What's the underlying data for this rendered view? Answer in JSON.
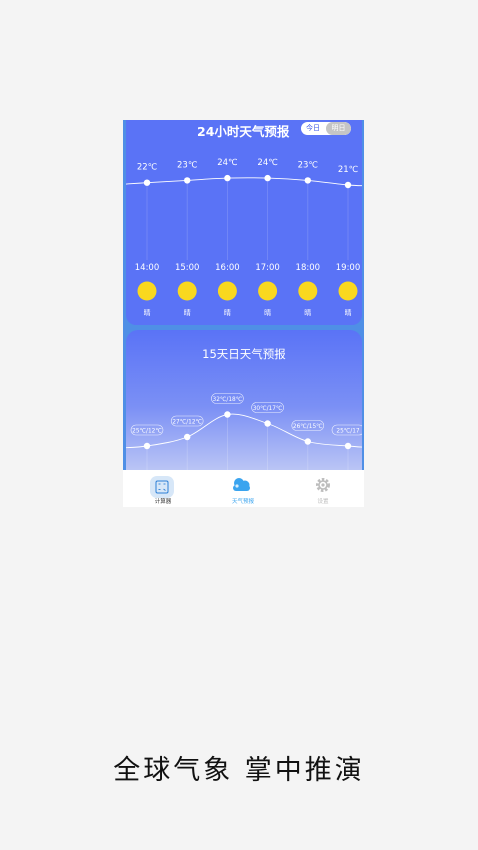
{
  "hourly": {
    "title": "24小时天气预报",
    "toggle": {
      "today": "今日",
      "tomorrow": "明日"
    },
    "items": [
      {
        "temp": "22℃",
        "temp_value": 22,
        "time": "14:00",
        "condition": "晴"
      },
      {
        "temp": "23℃",
        "temp_value": 23,
        "time": "15:00",
        "condition": "晴"
      },
      {
        "temp": "24℃",
        "temp_value": 24,
        "time": "16:00",
        "condition": "晴"
      },
      {
        "temp": "24℃",
        "temp_value": 24,
        "time": "17:00",
        "condition": "晴"
      },
      {
        "temp": "23℃",
        "temp_value": 23,
        "time": "18:00",
        "condition": "晴"
      },
      {
        "temp": "21℃",
        "temp_value": 21,
        "time": "19:00",
        "condition": "晴"
      }
    ]
  },
  "daily": {
    "title": "15天日天气预报",
    "items": [
      {
        "label": "25℃/12℃",
        "high": 25,
        "low": 12
      },
      {
        "label": "27℃/12℃",
        "high": 27,
        "low": 12
      },
      {
        "label": "32℃/18℃",
        "high": 32,
        "low": 18
      },
      {
        "label": "30℃/17℃",
        "high": 30,
        "low": 17
      },
      {
        "label": "26℃/15℃",
        "high": 26,
        "low": 15
      },
      {
        "label": "25℃/17",
        "high": 25,
        "low": 17
      }
    ]
  },
  "nav": {
    "calculator": "计算器",
    "weather": "天气预报",
    "settings": "设置"
  },
  "caption": "全球气象 掌中推演",
  "colors": {
    "background": "#f4f4f4",
    "card": "#5a73f6",
    "sun": "#f9d81f",
    "nav_active": "#3aa4ef",
    "nav_inactive": "#bdbdbd"
  }
}
